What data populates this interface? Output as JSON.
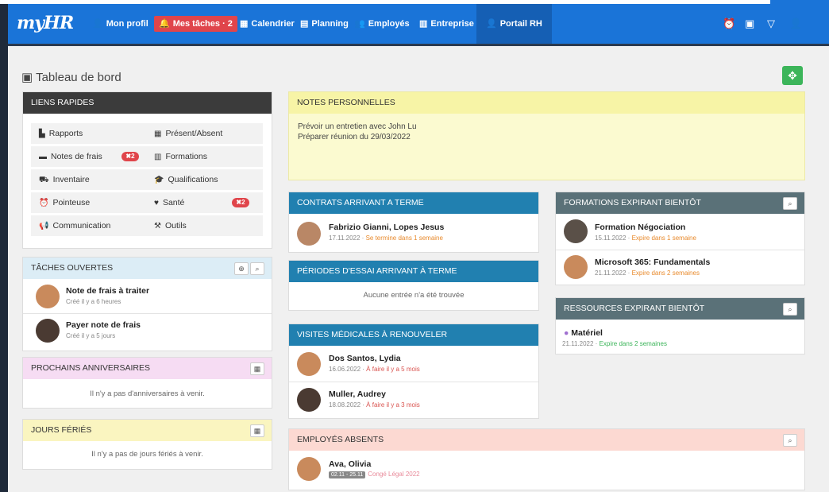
{
  "nav": {
    "brand": "myHR",
    "items": [
      {
        "label": "Mon profil",
        "icon": "👤"
      },
      {
        "label": "Mes tâches · 2",
        "icon": "🔔"
      },
      {
        "label": "Calendrier",
        "icon": "▦"
      },
      {
        "label": "Planning",
        "icon": "▤"
      },
      {
        "label": "Employés",
        "icon": "👥"
      },
      {
        "label": "Entreprise",
        "icon": "▥"
      },
      {
        "label": "Portail RH",
        "icon": "👤"
      }
    ],
    "right_icons": [
      "⏰",
      "▣",
      "▽",
      "👤"
    ]
  },
  "page": {
    "title": "Tableau de bord",
    "add_label": "✥"
  },
  "quick_links": {
    "title": "LIENS RAPIDES",
    "items": [
      {
        "label": "Rapports",
        "icon": "▙"
      },
      {
        "label": "Présent/Absent",
        "icon": "▦"
      },
      {
        "label": "Notes de frais",
        "icon": "▬",
        "badge": "✖2"
      },
      {
        "label": "Formations",
        "icon": "▥"
      },
      {
        "label": "Inventaire",
        "icon": "⛟"
      },
      {
        "label": "Qualifications",
        "icon": "🎓"
      },
      {
        "label": "Pointeuse",
        "icon": "⏰"
      },
      {
        "label": "Santé",
        "icon": "♥",
        "badge": "✖2"
      },
      {
        "label": "Communication",
        "icon": "📢"
      },
      {
        "label": "Outils",
        "icon": "⚒"
      }
    ]
  },
  "tasks": {
    "title": "TÂCHES OUVERTES",
    "items": [
      {
        "title": "Note de frais à traiter",
        "sub": "Créé il y a 6 heures"
      },
      {
        "title": "Payer note de frais",
        "sub": "Créé il y a 5 jours"
      }
    ]
  },
  "birthdays": {
    "title": "PROCHAINS ANNIVERSAIRES",
    "empty": "Il n'y a pas d'anniversaires à venir."
  },
  "holidays": {
    "title": "JOURS FÉRIÉS",
    "empty": "Il n'y a pas de jours fériés à venir."
  },
  "notes": {
    "title": "NOTES PERSONNELLES",
    "lines": [
      "Prévoir un entretien avec John Lu",
      "Préparer réunion du 29/03/2022"
    ]
  },
  "contracts": {
    "title": "CONTRATS ARRIVANT A TERME",
    "items": [
      {
        "title": "Fabrizio Gianni, Lopes Jesus",
        "date": "17.11.2022",
        "status": "Se termine dans 1 semaine"
      }
    ]
  },
  "trial": {
    "title": "PÉRIODES D'ESSAI ARRIVANT À TERME",
    "empty": "Aucune entrée n'a été trouvée"
  },
  "medical": {
    "title": "VISITES MÉDICALES À RENOUVELER",
    "items": [
      {
        "title": "Dos Santos, Lydia",
        "date": "16.06.2022",
        "status": "À faire il y a 5 mois"
      },
      {
        "title": "Muller, Audrey",
        "date": "18.08.2022",
        "status": "À faire il y a 3 mois"
      }
    ]
  },
  "trainings": {
    "title": "FORMATIONS EXPIRANT BIENTÔT",
    "items": [
      {
        "title": "Formation Négociation",
        "date": "15.11.2022",
        "status": "Expire dans 1 semaine"
      },
      {
        "title": "Microsoft 365: Fundamentals",
        "date": "21.11.2022",
        "status": "Expire dans 2 semaines"
      }
    ]
  },
  "resources": {
    "title": "RESSOURCES EXPIRANT BIENTÔT",
    "items": [
      {
        "title": "Matériel",
        "date": "21.11.2022",
        "status": "Expire dans 2 semaines"
      }
    ]
  },
  "absent": {
    "title": "EMPLOYÉS ABSENTS",
    "items": [
      {
        "title": "Ava, Olivia",
        "range": "02.11 - 25.11",
        "type": "Congé Légal 2022"
      }
    ]
  },
  "colors": {
    "nav_blue": "#1a74d8",
    "accent_green": "#3cb55a",
    "badge_red": "#e0454b"
  }
}
